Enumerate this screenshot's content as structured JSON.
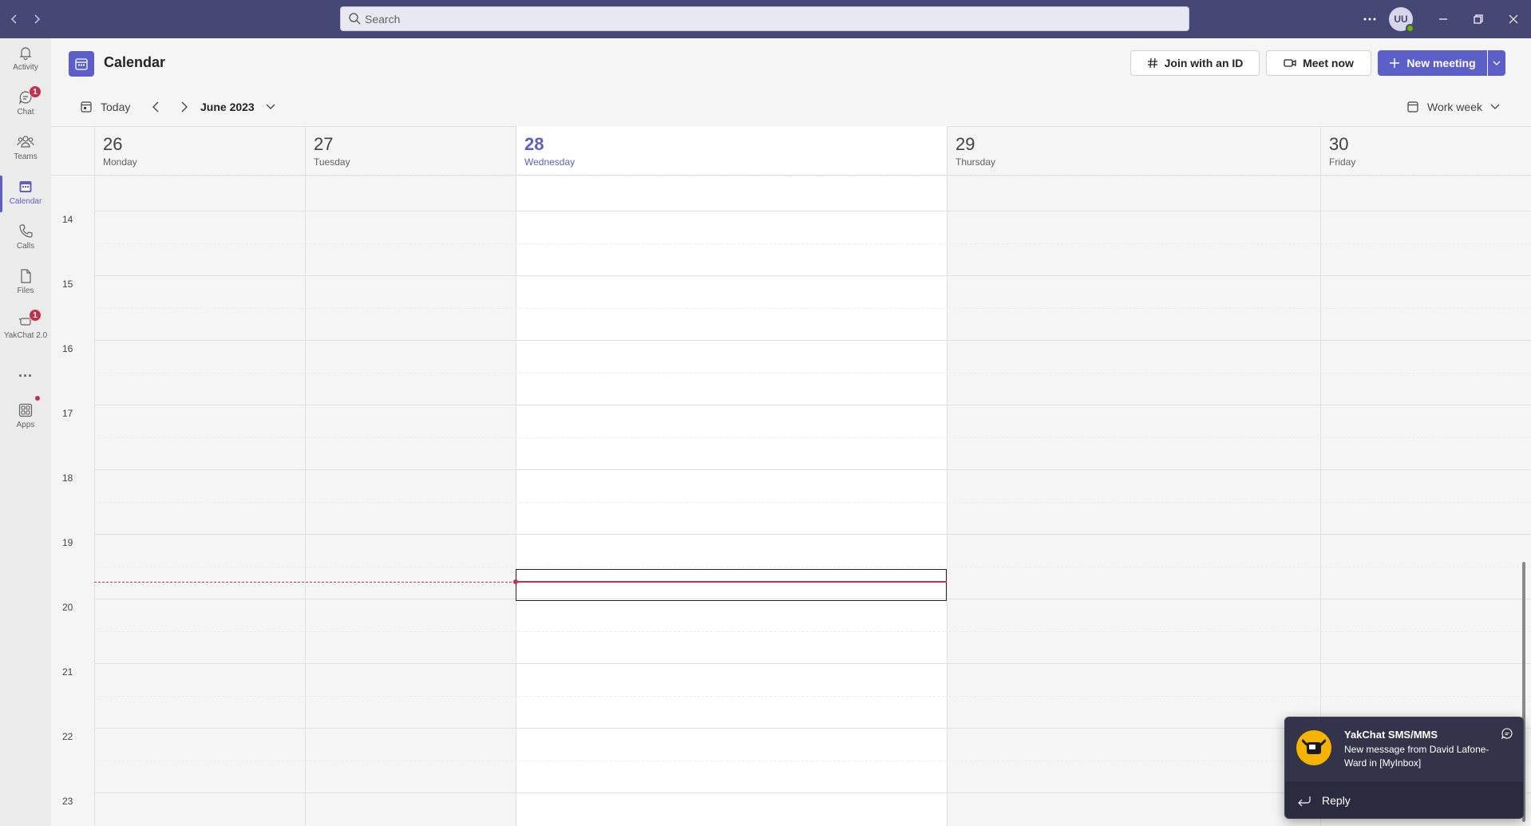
{
  "titlebar": {
    "search_placeholder": "Search",
    "avatar_initials": "UU"
  },
  "rail": {
    "items": [
      {
        "label": "Activity",
        "icon": "bell-icon"
      },
      {
        "label": "Chat",
        "icon": "chat-icon",
        "badge": "1"
      },
      {
        "label": "Teams",
        "icon": "teams-icon"
      },
      {
        "label": "Calendar",
        "icon": "calendar-icon",
        "active": true
      },
      {
        "label": "Calls",
        "icon": "phone-icon"
      },
      {
        "label": "Files",
        "icon": "file-icon"
      },
      {
        "label": "YakChat 2.0",
        "icon": "yakchat-icon",
        "badge": "1"
      },
      {
        "label": "Apps",
        "icon": "apps-icon"
      }
    ],
    "more_label": "..."
  },
  "header": {
    "title": "Calendar",
    "join_label": "Join with an ID",
    "meet_label": "Meet now",
    "new_meeting_label": "New meeting"
  },
  "nav": {
    "today_label": "Today",
    "month_label": "June 2023",
    "view_label": "Work week"
  },
  "days": [
    {
      "num": "26",
      "name": "Monday"
    },
    {
      "num": "27",
      "name": "Tuesday"
    },
    {
      "num": "28",
      "name": "Wednesday",
      "today": true
    },
    {
      "num": "29",
      "name": "Thursday"
    },
    {
      "num": "30",
      "name": "Friday"
    }
  ],
  "hours": [
    "14",
    "15",
    "16",
    "17",
    "18",
    "19",
    "20",
    "21",
    "22",
    "23"
  ],
  "toast": {
    "title": "YakChat SMS/MMS",
    "body": "New message from David Lafone-Ward in [MyInbox]",
    "reply_label": "Reply"
  },
  "colors": {
    "brand": "#464775",
    "accent": "#5b5fc7",
    "current_time": "#c4314b"
  }
}
